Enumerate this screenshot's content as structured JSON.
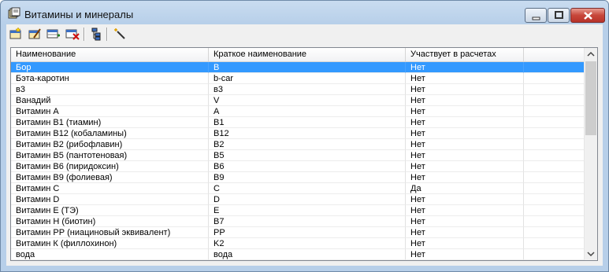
{
  "window": {
    "title": "Витамины и минералы"
  },
  "toolbar": {
    "buttons": [
      "new-icon",
      "edit-icon",
      "add-row-icon",
      "delete-row-icon",
      "tree-icon",
      "wand-icon"
    ]
  },
  "table": {
    "columns": [
      "Наименование",
      "Краткое наименование",
      "Участвует в расчетах",
      ""
    ],
    "rows": [
      [
        "Бор",
        "B",
        "Нет"
      ],
      [
        "Бэта-каротин",
        "b-car",
        "Нет"
      ],
      [
        "в3",
        "в3",
        "Нет"
      ],
      [
        "Ванадий",
        "V",
        "Нет"
      ],
      [
        "Витамин А",
        "А",
        "Нет"
      ],
      [
        "Витамин В1 (тиамин)",
        "B1",
        "Нет"
      ],
      [
        "Витамин В12 (кобаламины)",
        "B12",
        "Нет"
      ],
      [
        "Витамин В2 (рибофлавин)",
        "B2",
        "Нет"
      ],
      [
        "Витамин В5 (пантотеновая)",
        "B5",
        "Нет"
      ],
      [
        "Витамин В6 (пиридоксин)",
        "B6",
        "Нет"
      ],
      [
        "Витамин В9 (фолиевая)",
        "B9",
        "Нет"
      ],
      [
        "Витамин С",
        "C",
        "Да"
      ],
      [
        "Витамин D",
        "D",
        "Нет"
      ],
      [
        "Витамин Е (ТЭ)",
        "E",
        "Нет"
      ],
      [
        "Витамин Н (биотин)",
        "B7",
        "Нет"
      ],
      [
        "Витамин РР (ниациновый эквивалент)",
        "PP",
        "Нет"
      ],
      [
        "Витамин К (филлохинон)",
        "K2",
        "Нет"
      ],
      [
        "вода",
        "вода",
        "Нет"
      ]
    ],
    "selected_row": 0
  },
  "colors": {
    "selection": "#3399ff",
    "close_button": "#c7463a"
  }
}
